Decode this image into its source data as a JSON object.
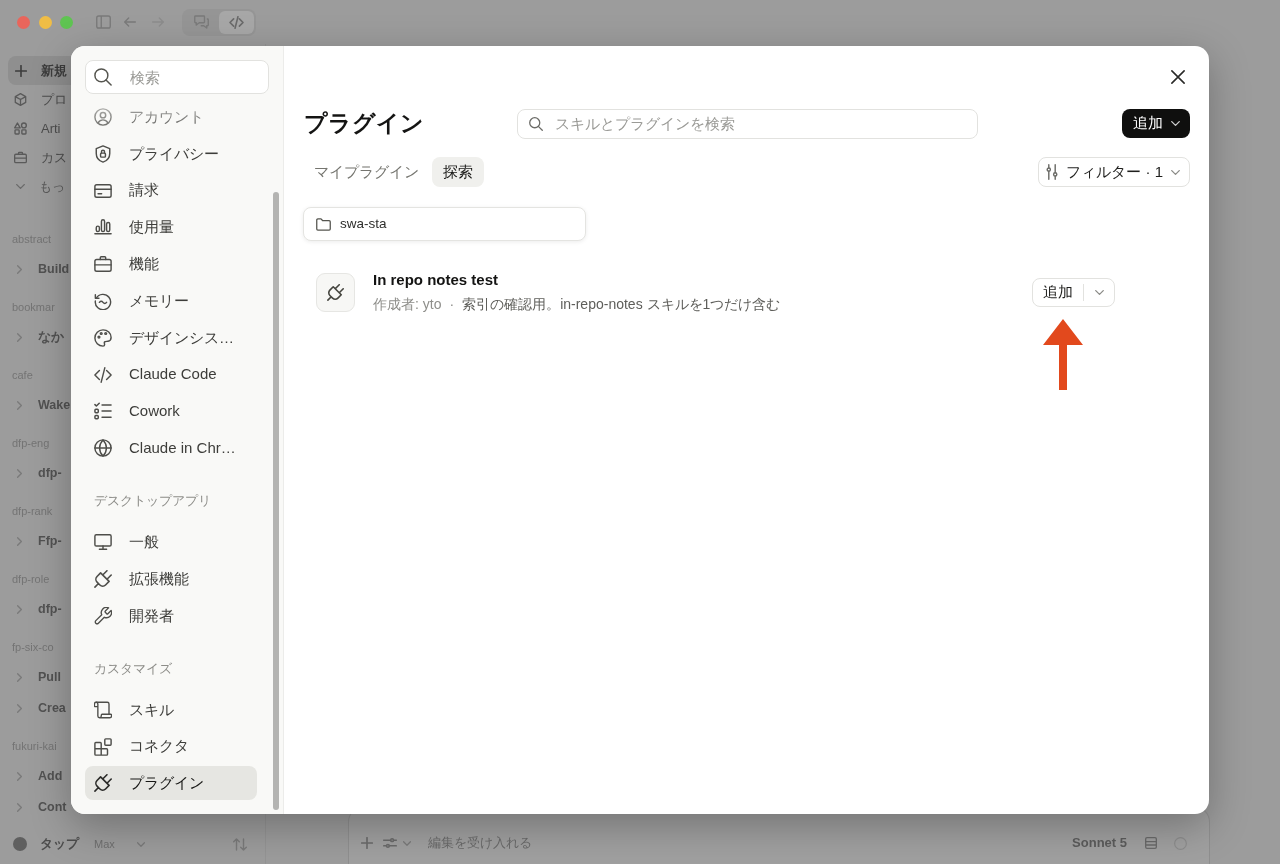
{
  "app": {
    "sidebar": [
      {
        "kind": "new",
        "label": "新規"
      },
      {
        "kind": "nav",
        "label": "プロ"
      },
      {
        "kind": "nav",
        "label": "Arti"
      },
      {
        "kind": "nav",
        "label": "カス"
      },
      {
        "kind": "more",
        "label": "もっ"
      },
      {
        "kind": "group",
        "label": "abstract"
      },
      {
        "kind": "thread",
        "label": "Build"
      },
      {
        "kind": "group",
        "label": "bookmar"
      },
      {
        "kind": "thread",
        "label": "なか"
      },
      {
        "kind": "group",
        "label": "cafe"
      },
      {
        "kind": "thread",
        "label": "Wake"
      },
      {
        "kind": "group",
        "label": "dfp-eng"
      },
      {
        "kind": "thread",
        "label": "dfp-"
      },
      {
        "kind": "group",
        "label": "dfp-rank"
      },
      {
        "kind": "thread",
        "label": "Ffp-"
      },
      {
        "kind": "group",
        "label": "dfp-role"
      },
      {
        "kind": "thread",
        "label": "dfp-"
      },
      {
        "kind": "group",
        "label": "fp-six-co"
      },
      {
        "kind": "thread",
        "label": "Pull"
      },
      {
        "kind": "thread",
        "label": "Crea"
      },
      {
        "kind": "group",
        "label": "fukuri-kai"
      },
      {
        "kind": "thread",
        "label": "Add"
      },
      {
        "kind": "thread",
        "label": "Cont"
      }
    ],
    "account": {
      "name": "タップ",
      "plan": "Max"
    },
    "composer": {
      "mode": "編集を受け入れる",
      "model": "Sonnet 5"
    }
  },
  "settings_dialog": {
    "sidebar": {
      "search": {
        "placeholder": "検索"
      },
      "sections": [
        {
          "items": [
            {
              "label": "アカウント",
              "selected": false
            },
            {
              "label": "プライバシー",
              "selected": false
            },
            {
              "label": "請求",
              "selected": false
            },
            {
              "label": "使用量",
              "selected": false
            },
            {
              "label": "機能",
              "selected": false
            },
            {
              "label": "メモリー",
              "selected": false
            },
            {
              "label": "デザインシス…",
              "selected": false
            },
            {
              "label": "Claude Code",
              "selected": false
            },
            {
              "label": "Cowork",
              "selected": false
            },
            {
              "label": "Claude in Chr…",
              "selected": false
            }
          ]
        },
        {
          "header": "デスクトップアプリ",
          "items": [
            {
              "label": "一般",
              "selected": false
            },
            {
              "label": "拡張機能",
              "selected": false
            },
            {
              "label": "開発者",
              "selected": false
            }
          ]
        },
        {
          "header": "カスタマイズ",
          "items": [
            {
              "label": "スキル",
              "selected": false
            },
            {
              "label": "コネクタ",
              "selected": false
            },
            {
              "label": "プラグイン",
              "selected": true
            }
          ]
        }
      ]
    },
    "page": {
      "title": "プラグイン",
      "search": {
        "placeholder": "スキルとプラグインを検索"
      },
      "add_button": {
        "label": "追加"
      },
      "tabs": [
        {
          "label": "マイプラグイン",
          "selected": false
        },
        {
          "label": "探索",
          "selected": true
        }
      ],
      "filter_button": {
        "label": "フィルター · 1"
      },
      "folder": {
        "label": "swa-sta"
      },
      "plugins": [
        {
          "name": "In repo notes test",
          "author": "作成者: yto",
          "separator": "·",
          "description": "索引の確認用。in-repo-notes スキルを1つだけ含む",
          "add_button": "追加"
        }
      ]
    }
  }
}
